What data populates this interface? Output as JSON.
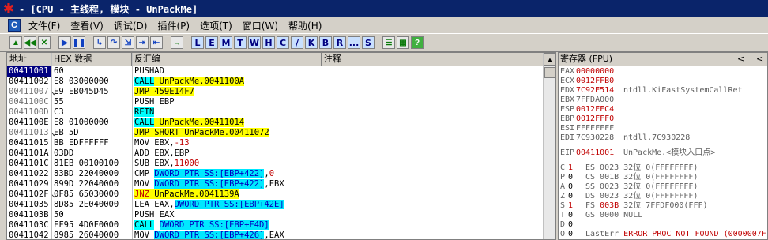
{
  "title": "- [CPU - 主线程, 模块 - UnPackMe]",
  "menu": [
    "文件(F)",
    "查看(V)",
    "调试(D)",
    "插件(P)",
    "选项(T)",
    "窗口(W)",
    "帮助(H)"
  ],
  "toolbar": {
    "letters": [
      "L",
      "E",
      "M",
      "T",
      "W",
      "H",
      "C",
      "/",
      "K",
      "B",
      "R",
      "...",
      "S"
    ]
  },
  "columns": {
    "addr": "地址",
    "hex": "HEX 数据",
    "dis": "反汇编",
    "comment": "注释"
  },
  "rows": [
    {
      "addr": "00411001",
      "mark": " ",
      "hex": "60",
      "dis": "PUSHAD",
      "style": "plain",
      "sel": true
    },
    {
      "addr": "00411002",
      "mark": " ",
      "hex": "E8 03000000",
      "op": "CALL",
      "arg": "UnPackMe.0041100A",
      "style": "call"
    },
    {
      "addr": "00411007",
      "mark": "⌄",
      "hex": "E9 EB045D45",
      "op": "JMP",
      "arg": "459E14F7",
      "style": "jmp",
      "grey": true
    },
    {
      "addr": "0041100C",
      "mark": " ",
      "hex": "55",
      "dis": "PUSH EBP",
      "style": "plain",
      "grey": true
    },
    {
      "addr": "0041100D",
      "mark": " ",
      "hex": "C3",
      "op": "RETN",
      "arg": "",
      "style": "retn",
      "grey": true
    },
    {
      "addr": "0041100E",
      "mark": " ",
      "hex": "E8 01000000",
      "op": "CALL",
      "arg": "UnPackMe.00411014",
      "style": "call"
    },
    {
      "addr": "00411013",
      "mark": "⌄",
      "hex": "EB 5D",
      "op": "JMP",
      "arg": "SHORT UnPackMe.00411072",
      "style": "jmp",
      "grey": true
    },
    {
      "addr": "00411015",
      "mark": " ",
      "hex": "BB EDFFFFFF",
      "dis": "MOV EBX,",
      "num": "-13",
      "style": "num"
    },
    {
      "addr": "0041101A",
      "mark": " ",
      "hex": "03DD",
      "dis": "ADD EBX,EBP",
      "style": "plain"
    },
    {
      "addr": "0041101C",
      "mark": " ",
      "hex": "81EB 00100100",
      "dis": "SUB EBX,",
      "num": "11000",
      "style": "num"
    },
    {
      "addr": "00411022",
      "mark": " ",
      "hex": "83BD 22040000",
      "dis": "CMP ",
      "mem": "DWORD PTR SS:[EBP+422]",
      "tail": ",",
      "num": "0",
      "style": "mem"
    },
    {
      "addr": "00411029",
      "mark": " ",
      "hex": "899D 22040000",
      "dis": "MOV ",
      "mem": "DWORD PTR SS:[EBP+422]",
      "tail": ",EBX",
      "style": "mem"
    },
    {
      "addr": "0041102F",
      "mark": "⌄",
      "hex": "0F85 65030000",
      "op": "JNZ",
      "arg": "UnPackMe.0041139A",
      "style": "jnz"
    },
    {
      "addr": "00411035",
      "mark": " ",
      "hex": "8D85 2E040000",
      "dis": "LEA EAX,",
      "mem": "DWORD PTR SS:[EBP+42E]",
      "tail": "",
      "style": "mem"
    },
    {
      "addr": "0041103B",
      "mark": " ",
      "hex": "50",
      "dis": "PUSH EAX",
      "style": "plain"
    },
    {
      "addr": "0041103C",
      "mark": " ",
      "hex": "FF95 4D0F0000",
      "op": "CALL",
      "arg": "",
      "mem": "DWORD PTR SS:[EBP+F4D]",
      "style": "callmem"
    },
    {
      "addr": "00411042",
      "mark": " ",
      "hex": "8985 26040000",
      "dis": "MOV ",
      "mem": "DWORD PTR SS:[EBP+426]",
      "tail": ",EAX",
      "style": "mem"
    },
    {
      "addr": "00411048",
      "mark": " ",
      "hex": "8BF8",
      "dis": "MOV EDI,EAX",
      "style": "plain"
    }
  ],
  "regs_title": "寄存器 (FPU)",
  "regs_nav": [
    "<",
    "<"
  ],
  "registers": [
    {
      "n": "EAX",
      "v": "00000000",
      "c": "",
      "vc": "red"
    },
    {
      "n": "ECX",
      "v": "0012FFB0",
      "c": "",
      "vc": "red"
    },
    {
      "n": "EDX",
      "v": "7C92E514",
      "c": "ntdll.KiFastSystemCallRet",
      "vc": "red"
    },
    {
      "n": "EBX",
      "v": "7FFDA000",
      "c": "",
      "vc": "gry"
    },
    {
      "n": "ESP",
      "v": "0012FFC4",
      "c": "",
      "vc": "red"
    },
    {
      "n": "EBP",
      "v": "0012FFF0",
      "c": "",
      "vc": "red"
    },
    {
      "n": "ESI",
      "v": "FFFFFFFF",
      "c": "",
      "vc": "gry"
    },
    {
      "n": "EDI",
      "v": "7C930228",
      "c": "ntdll.7C930228",
      "vc": "gry"
    }
  ],
  "eip": {
    "n": "EIP",
    "v": "00411001",
    "c": "UnPackMe.<模块入口点>"
  },
  "flags": [
    {
      "f": "C",
      "v": "1",
      "red": true,
      "seg": "ES 0023 32位 0(FFFFFFFF)"
    },
    {
      "f": "P",
      "v": "0",
      "red": false,
      "seg": "CS 001B 32位 0(FFFFFFFF)"
    },
    {
      "f": "A",
      "v": "0",
      "red": false,
      "seg": "SS 0023 32位 0(FFFFFFFF)"
    },
    {
      "f": "Z",
      "v": "0",
      "red": false,
      "seg": "DS 0023 32位 0(FFFFFFFF)"
    },
    {
      "f": "S",
      "v": "1",
      "red": true,
      "seg": "FS 003B 32位 7FFDF000(FFF)",
      "segRed": "003B"
    },
    {
      "f": "T",
      "v": "0",
      "red": false,
      "seg": "GS 0000 NULL"
    },
    {
      "f": "D",
      "v": "0",
      "red": false,
      "seg": ""
    }
  ],
  "lasterr": {
    "f": "O",
    "v": "0",
    "label": "LastErr",
    "value": "ERROR_PROC_NOT_FOUND (0000007F)"
  },
  "colors": {
    "titlebar": "#0a246a",
    "highlight_yellow": "#ffff00",
    "highlight_cyan": "#00ffff",
    "red": "#c00000"
  }
}
